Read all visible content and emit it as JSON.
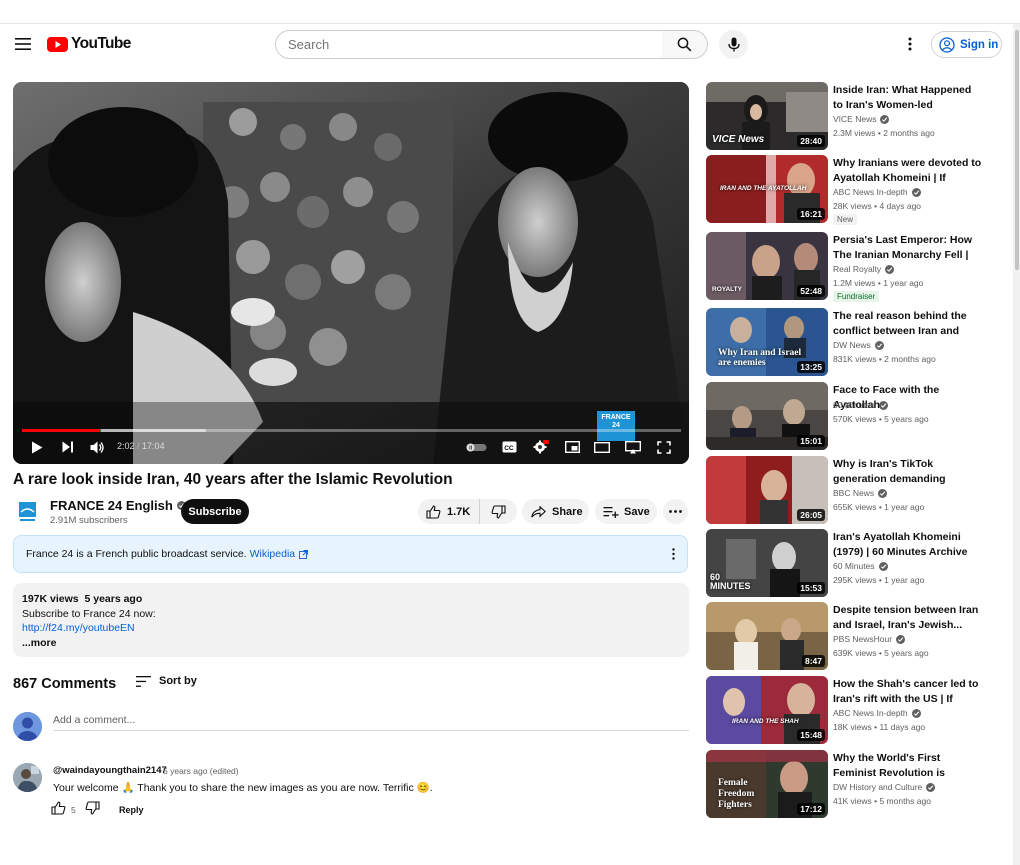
{
  "header": {
    "logo_text": "YouTube",
    "search_placeholder": "Search",
    "signin_label": "Sign in"
  },
  "player": {
    "current_time": "2:02",
    "duration": "17:04",
    "progress_fraction": 0.119,
    "watermark_text": "FRANCE 24",
    "hd_badge": "HD"
  },
  "video": {
    "title": "A rare look inside Iran, 40 years after the Islamic Revolution",
    "channel_name": "FRANCE 24 English",
    "subscribers": "2.91M subscribers",
    "subscribe_label": "Subscribe",
    "likes": "1.7K",
    "share_label": "Share",
    "save_label": "Save"
  },
  "info_panel": {
    "text": "France 24 is a French public broadcast service.",
    "link_text": "Wikipedia"
  },
  "description": {
    "views": "197K views",
    "age": "5 years ago",
    "line1": "Subscribe to France 24 now:",
    "link": "http://f24.my/youtubeEN",
    "more": "...more"
  },
  "comments": {
    "count": "867 Comments",
    "sort_label": "Sort by",
    "add_placeholder": "Add a comment...",
    "items": [
      {
        "author": "@waindayoungthain2147",
        "time": "5 years ago (edited)",
        "text": "Your welcome 🙏 Thank you to share the new images as you are now. Terrific 😊.",
        "likes": "5",
        "reply_label": "Reply"
      }
    ]
  },
  "sidebar": {
    "items": [
      {
        "title": "Inside Iran: What Happened to Iran's Women-led Uprising?",
        "channel": "VICE News",
        "stats": "2.3M views • 2 months ago",
        "duration": "28:40",
        "badge": "",
        "thumb_text": "VICE News"
      },
      {
        "title": "Why Iranians were devoted to Ayatollah Khomeini | If You're...",
        "channel": "ABC News In-depth",
        "stats": "28K views • 4 days ago",
        "duration": "16:21",
        "badge": "New",
        "thumb_text": "IRAN AND THE AYATOLLAH"
      },
      {
        "title": "Persia's Last Emperor: How The Iranian Monarchy Fell | Last...",
        "channel": "Real Royalty",
        "stats": "1.2M views • 1 year ago",
        "duration": "52:48",
        "badge": "Fundraiser",
        "thumb_text": "ROYALTY"
      },
      {
        "title": "The real reason behind the conflict between Iran and Isra...",
        "channel": "DW News",
        "stats": "831K views • 2 months ago",
        "duration": "13:25",
        "badge": "",
        "thumb_text": "Why Iran and Israel are enemies"
      },
      {
        "title": "Face to Face with the Ayatollah",
        "channel": "60 Minutes",
        "stats": "570K views • 5 years ago",
        "duration": "15:01",
        "badge": "",
        "thumb_text": ""
      },
      {
        "title": "Why is Iran's TikTok generation demanding 'Women, Life,...",
        "channel": "BBC News",
        "stats": "655K views • 1 year ago",
        "duration": "26:05",
        "badge": "",
        "thumb_text": ""
      },
      {
        "title": "Iran's Ayatollah Khomeini (1979) | 60 Minutes Archive",
        "channel": "60 Minutes",
        "stats": "295K views • 1 year ago",
        "duration": "15:53",
        "badge": "",
        "thumb_text": "60 MINUTES"
      },
      {
        "title": "Despite tension between Iran and Israel, Iran's Jewish...",
        "channel": "PBS NewsHour",
        "stats": "639K views • 5 years ago",
        "duration": "8:47",
        "badge": "",
        "thumb_text": ""
      },
      {
        "title": "How the Shah's cancer led to Iran's rift with the US | If You're...",
        "channel": "ABC News In-depth",
        "stats": "18K views • 11 days ago",
        "duration": "15:48",
        "badge": "",
        "thumb_text": "IRAN AND THE SHAH"
      },
      {
        "title": "Why the World's First Feminist Revolution is Happening in Iran",
        "channel": "DW History and Culture",
        "stats": "41K views • 5 months ago",
        "duration": "17:12",
        "badge": "",
        "thumb_text": "Female Freedom Fighters"
      }
    ]
  }
}
